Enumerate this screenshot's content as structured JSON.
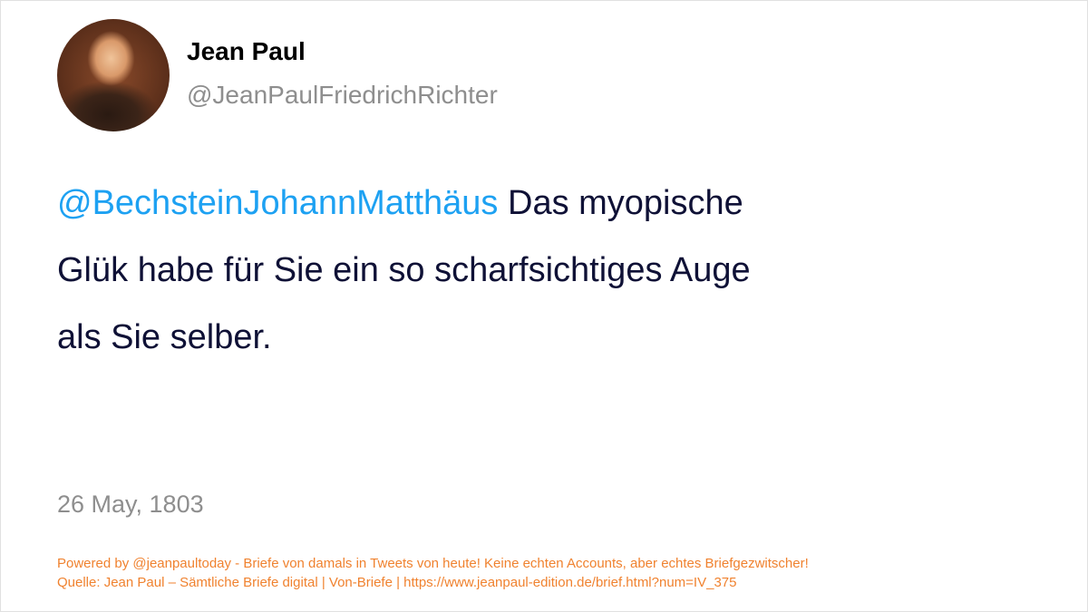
{
  "author": {
    "name": "Jean Paul",
    "handle": "@JeanPaulFriedrichRichter"
  },
  "tweet": {
    "mention": "@BechsteinJohannMatthäus",
    "line1_rest": " Das myopische",
    "line2": "Glük habe für Sie ein so scharfsichtiges Auge",
    "line3": "als Sie selber."
  },
  "date": "26 May, 1803",
  "footer": {
    "line1": "Powered by @jeanpaultoday - Briefe von damals in Tweets von heute! Keine echten Accounts, aber echtes Briefgezwitscher!",
    "line2": "Quelle: Jean Paul – Sämtliche Briefe digital | Von-Briefe | https://www.jeanpaul-edition.de/brief.html?num=IV_375"
  },
  "colors": {
    "mention": "#1da1f2",
    "footer": "#f0822f",
    "text": "#0f1136",
    "muted": "#8e8e8e"
  }
}
